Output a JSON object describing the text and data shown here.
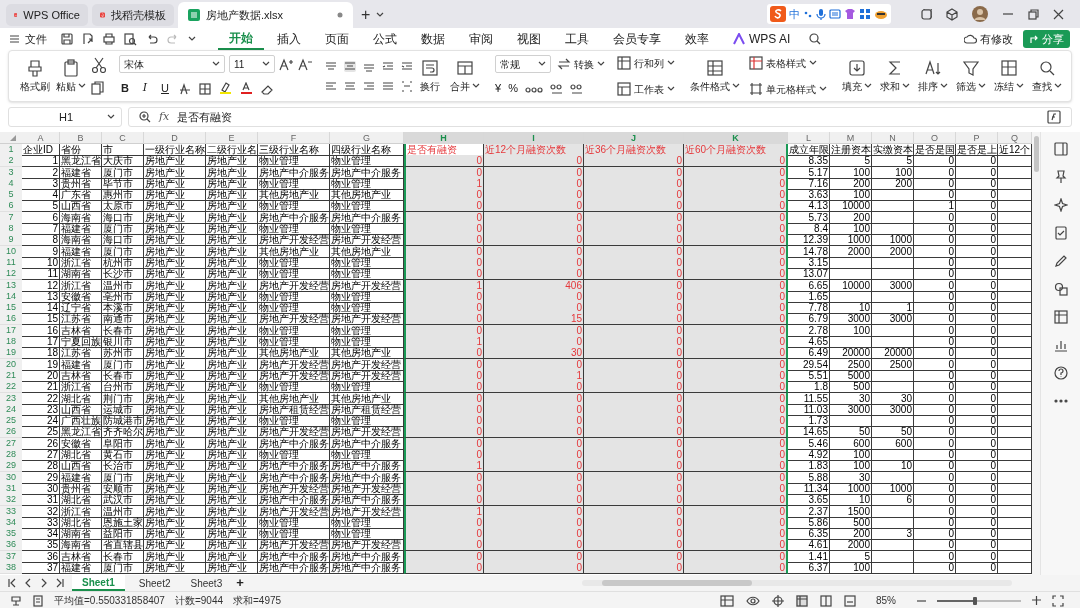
{
  "title_bar": {
    "tabs": [
      {
        "label": "WPS Office",
        "kind": "wps",
        "selected": false
      },
      {
        "label": "找稻壳模板",
        "kind": "template",
        "selected": false
      },
      {
        "label": "房地产数据.xlsx",
        "kind": "sheet",
        "selected": true
      }
    ],
    "new_tab": "+",
    "ime_mode": "中"
  },
  "menu": {
    "file": "文件",
    "tabs": [
      {
        "label": "开始",
        "selected": true
      },
      {
        "label": "插入",
        "selected": false
      },
      {
        "label": "页面",
        "selected": false
      },
      {
        "label": "公式",
        "selected": false
      },
      {
        "label": "数据",
        "selected": false
      },
      {
        "label": "审阅",
        "selected": false
      },
      {
        "label": "视图",
        "selected": false
      },
      {
        "label": "工具",
        "selected": false
      },
      {
        "label": "会员专享",
        "selected": false
      },
      {
        "label": "效率",
        "selected": false
      },
      {
        "label": "WPS AI",
        "selected": false
      }
    ],
    "modified": "有修改",
    "share": "分享"
  },
  "ribbon": {
    "clipboard": [
      "格式刷",
      "粘贴"
    ],
    "font": {
      "name": "宋体",
      "size": "11",
      "styles": [
        "B",
        "I",
        "U"
      ]
    },
    "alignment": [
      "换行",
      "合并"
    ],
    "number": {
      "format": "常规",
      "convert": "转换",
      "symbols": [
        "¥",
        "%"
      ]
    },
    "cells": [
      "行和列",
      "工作表"
    ],
    "styles": [
      "条件格式",
      "表格样式",
      "单元格样式"
    ],
    "editing": [
      "填充",
      "求和",
      "排序",
      "筛选",
      "冻结",
      "查找"
    ]
  },
  "formula_bar": {
    "cell": "H1",
    "fx": "fx",
    "content": "是否有融资"
  },
  "sheet": {
    "columns": [
      {
        "letter": "A",
        "kind": "number",
        "selected": false,
        "highlighted": false
      },
      {
        "letter": "B",
        "kind": "text",
        "selected": false,
        "highlighted": false
      },
      {
        "letter": "C",
        "kind": "text",
        "selected": false,
        "highlighted": false
      },
      {
        "letter": "D",
        "kind": "text",
        "selected": false,
        "highlighted": false
      },
      {
        "letter": "E",
        "kind": "text",
        "selected": false,
        "highlighted": false
      },
      {
        "letter": "F",
        "kind": "text",
        "selected": false,
        "highlighted": false
      },
      {
        "letter": "G",
        "kind": "text",
        "selected": false,
        "highlighted": false
      },
      {
        "letter": "H",
        "kind": "number",
        "selected": true,
        "highlighted": true
      },
      {
        "letter": "I",
        "kind": "number",
        "selected": true,
        "highlighted": true
      },
      {
        "letter": "J",
        "kind": "number",
        "selected": true,
        "highlighted": true
      },
      {
        "letter": "K",
        "kind": "number",
        "selected": true,
        "highlighted": true
      },
      {
        "letter": "L",
        "kind": "number",
        "selected": false,
        "highlighted": false
      },
      {
        "letter": "M",
        "kind": "number",
        "selected": false,
        "highlighted": false
      },
      {
        "letter": "N",
        "kind": "number",
        "selected": false,
        "highlighted": false
      },
      {
        "letter": "O",
        "kind": "number",
        "selected": false,
        "highlighted": false
      },
      {
        "letter": "P",
        "kind": "number",
        "selected": false,
        "highlighted": false
      },
      {
        "letter": "Q",
        "kind": "number",
        "selected": false,
        "highlighted": false
      }
    ],
    "rows": [
      {
        "number": "1",
        "cells": [
          "企业ID",
          "省份",
          "市",
          "一级行业名称",
          "二级行业名",
          "三级行业名称",
          "四级行业名称",
          "是否有融资",
          "近12个月融资次数",
          "近36个月融资次数",
          "近60个月融资次数",
          "成立年限",
          "注册资本",
          "实缴资本",
          "是否是国",
          "是否是上",
          "近12个"
        ]
      },
      {
        "number": "2",
        "cells": [
          "1",
          "黑龙江省",
          "大庆市",
          "房地产业",
          "房地产业",
          "物业管理",
          "物业管理",
          "0",
          "0",
          "0",
          "0",
          "8.35",
          "5",
          "5",
          "0",
          "0",
          null
        ]
      },
      {
        "number": "3",
        "cells": [
          "2",
          "福建省",
          "厦门市",
          "房地产业",
          "房地产业",
          "房地产中介服务",
          "房地产中介服务",
          "0",
          "0",
          "0",
          "0",
          "5.17",
          "100",
          "100",
          "0",
          "0",
          null
        ]
      },
      {
        "number": "4",
        "cells": [
          "3",
          "贵州省",
          "毕节市",
          "房地产业",
          "房地产业",
          "物业管理",
          "物业管理",
          "1",
          "0",
          "0",
          "0",
          "7.16",
          "200",
          "200",
          "0",
          "0",
          null
        ]
      },
      {
        "number": "5",
        "cells": [
          "4",
          "广东省",
          "惠州市",
          "房地产业",
          "房地产业",
          "其他房地产业",
          "其他房地产业",
          "0",
          "0",
          "0",
          "0",
          "3.63",
          "100",
          null,
          "0",
          "0",
          null
        ]
      },
      {
        "number": "6",
        "cells": [
          "5",
          "山西省",
          "太原市",
          "房地产业",
          "房地产业",
          "物业管理",
          "物业管理",
          "0",
          "0",
          "0",
          "0",
          "4.13",
          "10000",
          null,
          "1",
          "0",
          null
        ]
      },
      {
        "number": "7",
        "cells": [
          "6",
          "海南省",
          "海口市",
          "房地产业",
          "房地产业",
          "房地产中介服务",
          "房地产中介服务",
          "0",
          "0",
          "0",
          "0",
          "5.73",
          "200",
          null,
          "0",
          "0",
          null
        ]
      },
      {
        "number": "8",
        "cells": [
          "7",
          "福建省",
          "厦门市",
          "房地产业",
          "房地产业",
          "物业管理",
          "物业管理",
          "0",
          "0",
          "0",
          "0",
          "8.4",
          "100",
          null,
          "0",
          "0",
          null
        ]
      },
      {
        "number": "9",
        "cells": [
          "8",
          "海南省",
          "海口市",
          "房地产业",
          "房地产业",
          "房地产开发经营",
          "房地产开发经营",
          "0",
          "0",
          "0",
          "0",
          "12.39",
          "1000",
          "1000",
          "0",
          "0",
          null
        ]
      },
      {
        "number": "10",
        "cells": [
          "9",
          "福建省",
          "厦门市",
          "房地产业",
          "房地产业",
          "其他房地产业",
          "其他房地产业",
          "0",
          "0",
          "0",
          "0",
          "14.78",
          "2000",
          "2000",
          "0",
          "0",
          null
        ]
      },
      {
        "number": "11",
        "cells": [
          "10",
          "浙江省",
          "杭州市",
          "房地产业",
          "房地产业",
          "物业管理",
          "物业管理",
          "0",
          "0",
          "0",
          "0",
          "3.15",
          null,
          null,
          "0",
          "0",
          null
        ]
      },
      {
        "number": "12",
        "cells": [
          "11",
          "湖南省",
          "长沙市",
          "房地产业",
          "房地产业",
          "物业管理",
          "物业管理",
          "0",
          "0",
          "0",
          "0",
          "13.07",
          null,
          null,
          "0",
          "0",
          null
        ]
      },
      {
        "number": "13",
        "cells": [
          "12",
          "浙江省",
          "温州市",
          "房地产业",
          "房地产业",
          "房地产开发经营",
          "房地产开发经营",
          "1",
          "406",
          "0",
          "0",
          "6.65",
          "10000",
          "3000",
          "0",
          "0",
          null
        ]
      },
      {
        "number": "14",
        "cells": [
          "13",
          "安徽省",
          "亳州市",
          "房地产业",
          "房地产业",
          "物业管理",
          "物业管理",
          "0",
          "0",
          "0",
          "0",
          "1.65",
          null,
          null,
          "0",
          "0",
          null
        ]
      },
      {
        "number": "15",
        "cells": [
          "14",
          "辽宁省",
          "本溪市",
          "房地产业",
          "房地产业",
          "物业管理",
          "物业管理",
          "0",
          "0",
          "0",
          "0",
          "7.78",
          "10",
          "1",
          "0",
          "0",
          null
        ]
      },
      {
        "number": "16",
        "cells": [
          "15",
          "江苏省",
          "南通市",
          "房地产业",
          "房地产业",
          "房地产开发经营",
          "房地产开发经营",
          "0",
          "15",
          "0",
          "0",
          "6.79",
          "3000",
          "3000",
          "0",
          "0",
          null
        ]
      },
      {
        "number": "17",
        "cells": [
          "16",
          "吉林省",
          "长春市",
          "房地产业",
          "房地产业",
          "物业管理",
          "物业管理",
          "0",
          "0",
          "0",
          "0",
          "2.78",
          "100",
          null,
          "0",
          "0",
          null
        ]
      },
      {
        "number": "18",
        "cells": [
          "17",
          "宁夏回族",
          "银川市",
          "房地产业",
          "房地产业",
          "物业管理",
          "物业管理",
          "1",
          "0",
          "0",
          "0",
          "4.65",
          null,
          null,
          "0",
          "0",
          null
        ]
      },
      {
        "number": "19",
        "cells": [
          "18",
          "江苏省",
          "苏州市",
          "房地产业",
          "房地产业",
          "其他房地产业",
          "其他房地产业",
          "0",
          "30",
          "0",
          "0",
          "6.49",
          "20000",
          "20000",
          "0",
          "0",
          null
        ]
      },
      {
        "number": "20",
        "cells": [
          "19",
          "福建省",
          "厦门市",
          "房地产业",
          "房地产业",
          "房地产开发经营",
          "房地产开发经营",
          "0",
          "0",
          "0",
          "0",
          "29.54",
          "2500",
          "2500",
          "0",
          "0",
          null
        ]
      },
      {
        "number": "21",
        "cells": [
          "20",
          "吉林省",
          "长春市",
          "房地产业",
          "房地产业",
          "房地产开发经营",
          "房地产开发经营",
          "0",
          "1",
          "0",
          "0",
          "5.51",
          "5000",
          null,
          "0",
          "0",
          null
        ]
      },
      {
        "number": "22",
        "cells": [
          "21",
          "浙江省",
          "台州市",
          "房地产业",
          "房地产业",
          "物业管理",
          "物业管理",
          "0",
          "0",
          "0",
          "0",
          "1.8",
          "500",
          null,
          "0",
          "0",
          null
        ]
      },
      {
        "number": "23",
        "cells": [
          "22",
          "湖北省",
          "荆门市",
          "房地产业",
          "房地产业",
          "其他房地产业",
          "其他房地产业",
          "0",
          "0",
          "0",
          "0",
          "11.55",
          "30",
          "30",
          "0",
          "0",
          null
        ]
      },
      {
        "number": "24",
        "cells": [
          "23",
          "山西省",
          "运城市",
          "房地产业",
          "房地产业",
          "房地产租赁经营",
          "房地产租赁经营",
          "0",
          "0",
          "0",
          "0",
          "11.03",
          "3000",
          "3000",
          "0",
          "0",
          null
        ]
      },
      {
        "number": "25",
        "cells": [
          "24",
          "广西壮族",
          "防城港市",
          "房地产业",
          "房地产业",
          "物业管理",
          "物业管理",
          "0",
          "0",
          "0",
          "0",
          "1.73",
          null,
          null,
          "0",
          "0",
          null
        ]
      },
      {
        "number": "26",
        "cells": [
          "25",
          "黑龙江省",
          "齐齐哈尔",
          "房地产业",
          "房地产业",
          "房地产开发经营",
          "房地产开发经营",
          "0",
          "0",
          "0",
          "0",
          "14.65",
          "50",
          "50",
          "0",
          "0",
          null
        ]
      },
      {
        "number": "27",
        "cells": [
          "26",
          "安徽省",
          "阜阳市",
          "房地产业",
          "房地产业",
          "房地产中介服务",
          "房地产中介服务",
          "0",
          "0",
          "0",
          "0",
          "5.46",
          "600",
          "600",
          "0",
          "0",
          null
        ]
      },
      {
        "number": "28",
        "cells": [
          "27",
          "湖北省",
          "黄石市",
          "房地产业",
          "房地产业",
          "物业管理",
          "物业管理",
          "0",
          "0",
          "0",
          "0",
          "4.92",
          "100",
          null,
          "0",
          "0",
          null
        ]
      },
      {
        "number": "29",
        "cells": [
          "28",
          "山西省",
          "长治市",
          "房地产业",
          "房地产业",
          "房地产中介服务",
          "房地产中介服务",
          "1",
          "0",
          "0",
          "0",
          "1.83",
          "100",
          "10",
          "0",
          "0",
          null
        ]
      },
      {
        "number": "30",
        "cells": [
          "29",
          "福建省",
          "厦门市",
          "房地产业",
          "房地产业",
          "房地产中介服务",
          "房地产中介服务",
          "0",
          "0",
          "0",
          "0",
          "5.88",
          "30",
          null,
          "0",
          "0",
          null
        ]
      },
      {
        "number": "31",
        "cells": [
          "30",
          "贵州省",
          "安顺市",
          "房地产业",
          "房地产业",
          "房地产开发经营",
          "房地产开发经营",
          "0",
          "0",
          "0",
          "0",
          "11.34",
          "1000",
          "1000",
          "0",
          "0",
          null
        ]
      },
      {
        "number": "32",
        "cells": [
          "31",
          "湖北省",
          "武汉市",
          "房地产业",
          "房地产业",
          "房地产中介服务",
          "房地产中介服务",
          "0",
          "0",
          "0",
          "0",
          "3.65",
          "10",
          "6",
          "0",
          "0",
          null
        ]
      },
      {
        "number": "33",
        "cells": [
          "32",
          "浙江省",
          "温州市",
          "房地产业",
          "房地产业",
          "房地产开发经营",
          "房地产开发经营",
          "1",
          "0",
          "0",
          "0",
          "2.37",
          "1500",
          null,
          "0",
          "0",
          null
        ]
      },
      {
        "number": "34",
        "cells": [
          "33",
          "湖北省",
          "恩施土家",
          "房地产业",
          "房地产业",
          "物业管理",
          "物业管理",
          "0",
          "0",
          "0",
          "0",
          "5.86",
          "500",
          null,
          "0",
          "0",
          null
        ]
      },
      {
        "number": "35",
        "cells": [
          "34",
          "湖南省",
          "益阳市",
          "房地产业",
          "房地产业",
          "物业管理",
          "物业管理",
          "0",
          "0",
          "0",
          "0",
          "6.35",
          "200",
          "3",
          "0",
          "0",
          null
        ]
      },
      {
        "number": "36",
        "cells": [
          "35",
          "海南省",
          "省直辖县",
          "房地产业",
          "房地产业",
          "房地产开发经营",
          "房地产开发经营",
          "0",
          "0",
          "0",
          "0",
          "4.61",
          "2000",
          null,
          "0",
          "0",
          null
        ]
      },
      {
        "number": "37",
        "cells": [
          "36",
          "吉林省",
          "长春市",
          "房地产业",
          "房地产业",
          "房地产中介服务",
          "房地产中介服务",
          "0",
          "0",
          "0",
          "0",
          "1.41",
          "5",
          null,
          "0",
          "0",
          null
        ]
      },
      {
        "number": "38",
        "cells": [
          "37",
          "福建省",
          "厦门市",
          "房地产业",
          "房地产业",
          "房地产中介服务",
          "房地产中介服务",
          "0",
          "0",
          "0",
          "0",
          "6.37",
          "100",
          null,
          "0",
          "0",
          null
        ]
      }
    ]
  },
  "sheet_tabs": {
    "tabs": [
      {
        "label": "Sheet1",
        "selected": true
      },
      {
        "label": "Sheet2",
        "selected": false
      },
      {
        "label": "Sheet3",
        "selected": false
      }
    ],
    "add": "+"
  },
  "status_bar": {
    "average": "平均值=0.550331858407",
    "count": "计数=9044",
    "sum": "求和=4975",
    "zoom": "85%",
    "zoom_slider": {
      "level": 0.45
    }
  }
}
